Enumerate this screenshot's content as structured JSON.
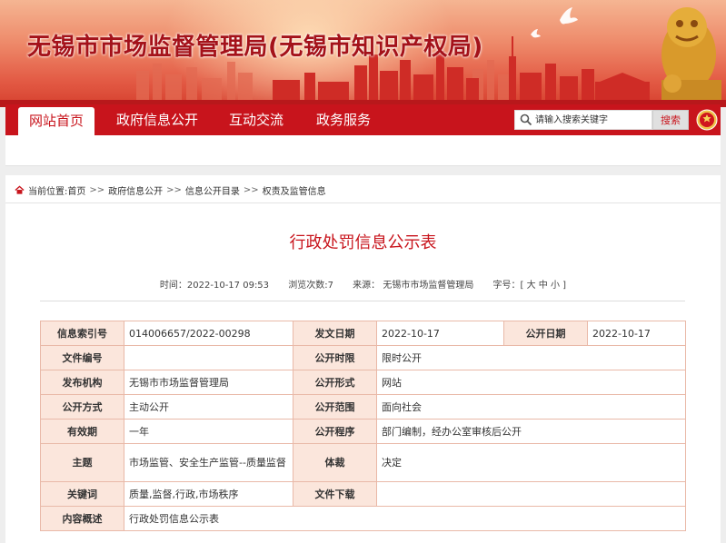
{
  "header": {
    "title": "无锡市市场监督管理局(无锡市知识产权局)"
  },
  "nav": {
    "items": [
      "网站首页",
      "政府信息公开",
      "互动交流",
      "政务服务"
    ],
    "search_placeholder": "请输入搜索关键字",
    "search_button": "搜索"
  },
  "breadcrumb": {
    "prefix": "当前位置:",
    "items": [
      "首页",
      "政府信息公开",
      "信息公开目录",
      "权责及监管信息"
    ],
    "separator": ">>"
  },
  "article": {
    "title": "行政处罚信息公示表",
    "time": "时间：2022-10-17 09:53",
    "views": "浏览次数:7",
    "source": "来源： 无锡市市场监督管理局",
    "font_size": "字号：[ 大 中 小 ]"
  },
  "info_table": {
    "index_no_label": "信息索引号",
    "index_no": "014006657/2022-00298",
    "issue_date_label": "发文日期",
    "issue_date": "2022-10-17",
    "public_date_label": "公开日期",
    "public_date": "2022-10-17",
    "doc_no_label": "文件编号",
    "doc_no": "",
    "public_time_label": "公开时限",
    "public_time": "限时公开",
    "publisher_label": "发布机构",
    "publisher": "无锡市市场监督管理局",
    "public_form_label": "公开形式",
    "public_form": "网站",
    "public_method_label": "公开方式",
    "public_method": "主动公开",
    "public_scope_label": "公开范围",
    "public_scope": "面向社会",
    "validity_label": "有效期",
    "validity": "一年",
    "procedure_label": "公开程序",
    "procedure": "部门编制，经办公室审核后公开",
    "topic_label": "主题",
    "topic": "市场监管、安全生产监管--质量监督",
    "genre_label": "体裁",
    "genre": "决定",
    "keywords_label": "关键词",
    "keywords": "质量,监督,行政,市场秩序",
    "download_label": "文件下载",
    "download": "",
    "summary_label": "内容概述",
    "summary": "行政处罚信息公示表"
  },
  "colors": {
    "primary_red": "#c8141c",
    "label_bg": "#fbe6dc",
    "border": "#e9b9a8"
  }
}
